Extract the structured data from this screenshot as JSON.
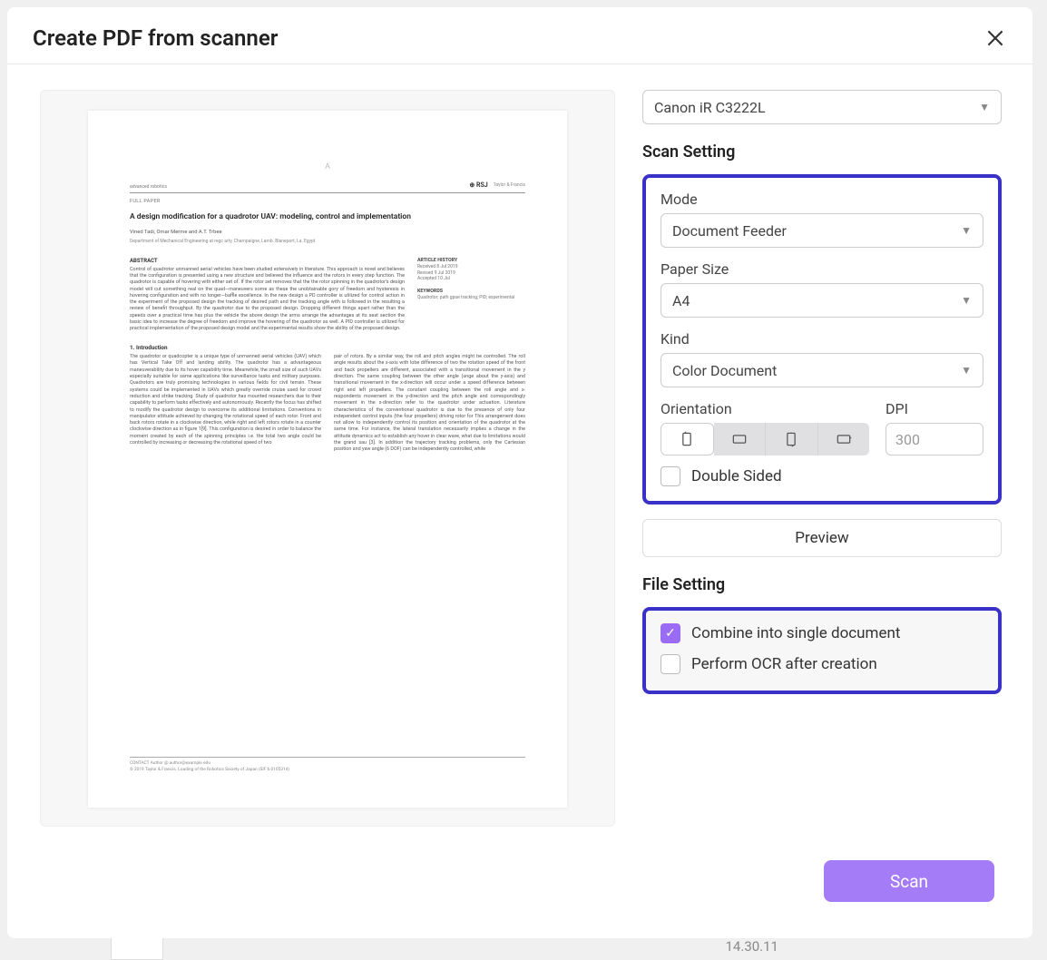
{
  "header": {
    "title": "Create PDF from scanner"
  },
  "scanner": {
    "selected": "Canon iR C3222L"
  },
  "scan_setting": {
    "title": "Scan Setting",
    "mode_label": "Mode",
    "mode_value": "Document Feeder",
    "paper_label": "Paper Size",
    "paper_value": "A4",
    "kind_label": "Kind",
    "kind_value": "Color Document",
    "orientation_label": "Orientation",
    "dpi_label": "DPI",
    "dpi_value": "300",
    "double_sided_label": "Double Sided",
    "preview_label": "Preview"
  },
  "file_setting": {
    "title": "File Setting",
    "combine_label": "Combine into single document",
    "ocr_label": "Perform OCR after creation"
  },
  "scan_button": "Scan",
  "bg_time": "14.30.11",
  "preview_doc": {
    "fullpaper": "FULL PAPER",
    "title": "A design modification for a quadrotor UAV: modeling, control and implementation",
    "authors": "Vined Tadi, Omar Merme and A.T.  Trbee",
    "affil": "Department of Mechanical Engineering at regc arty, Champaigne, Lamb. Blaneport, La. Egypt",
    "abstract_head": "ABSTRACT",
    "history_head": "ARTICLE HISTORY",
    "section1": "1.  Introduction"
  }
}
